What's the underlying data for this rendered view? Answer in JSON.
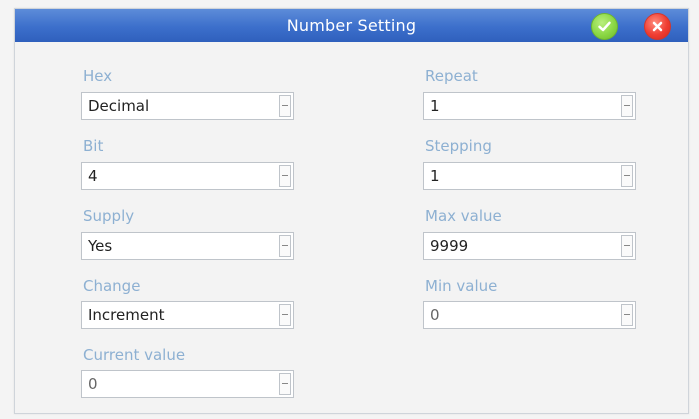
{
  "dialog": {
    "title": "Number Setting"
  },
  "fields": {
    "hex": {
      "label": "Hex",
      "value": "Decimal"
    },
    "bit": {
      "label": "Bit",
      "value": "4"
    },
    "supply": {
      "label": "Supply",
      "value": "Yes"
    },
    "change": {
      "label": "Change",
      "value": "Increment"
    },
    "current_value": {
      "label": "Current  value",
      "value": "0"
    },
    "repeat": {
      "label": "Repeat",
      "value": "1"
    },
    "stepping": {
      "label": "Stepping",
      "value": "1"
    },
    "max_value": {
      "label": "Max value",
      "value": "9999"
    },
    "min_value": {
      "label": "Min  value",
      "value": "0"
    }
  },
  "icons": {
    "ok": "checkmark-icon",
    "close": "close-icon"
  },
  "colors": {
    "titlebar": "#3c6fcb",
    "label": "#8db0d2",
    "ok": "#8bd744",
    "close": "#ef3d32"
  }
}
